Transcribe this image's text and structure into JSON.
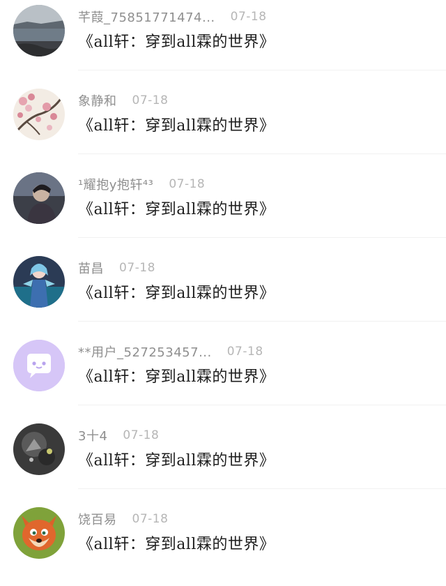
{
  "comments": [
    {
      "user": "芊葭_75851771474...",
      "date": "07-18",
      "text": "《all轩：穿到all霖的世界》",
      "avatar_icon": "lake-photo-icon"
    },
    {
      "user": "象静和",
      "date": "07-18",
      "text": "《all轩：穿到all霖的世界》",
      "avatar_icon": "plum-blossom-painting-icon"
    },
    {
      "user": "¹耀抱y抱轩⁴³",
      "date": "07-18",
      "text": "《all轩：穿到all霖的世界》",
      "avatar_icon": "person-photo-icon"
    },
    {
      "user": "苗昌",
      "date": "07-18",
      "text": "《all轩：穿到all霖的世界》",
      "avatar_icon": "anime-character-icon"
    },
    {
      "user": "**用户_527253457...",
      "date": "07-18",
      "text": "《all轩：穿到all霖的世界》",
      "avatar_icon": "default-chat-bubble-icon"
    },
    {
      "user": "3十4",
      "date": "07-18",
      "text": "《all轩：穿到all霖的世界》",
      "avatar_icon": "dark-abstract-icon"
    },
    {
      "user": "饶百易",
      "date": "07-18",
      "text": "《all轩：穿到all霖的世界》",
      "avatar_icon": "cartoon-fox-icon"
    }
  ],
  "colors": {
    "username": "#8f8f8f",
    "date": "#b6b6b6",
    "text": "#1e1e1e",
    "default_avatar_bg": "#d6c6f7"
  }
}
